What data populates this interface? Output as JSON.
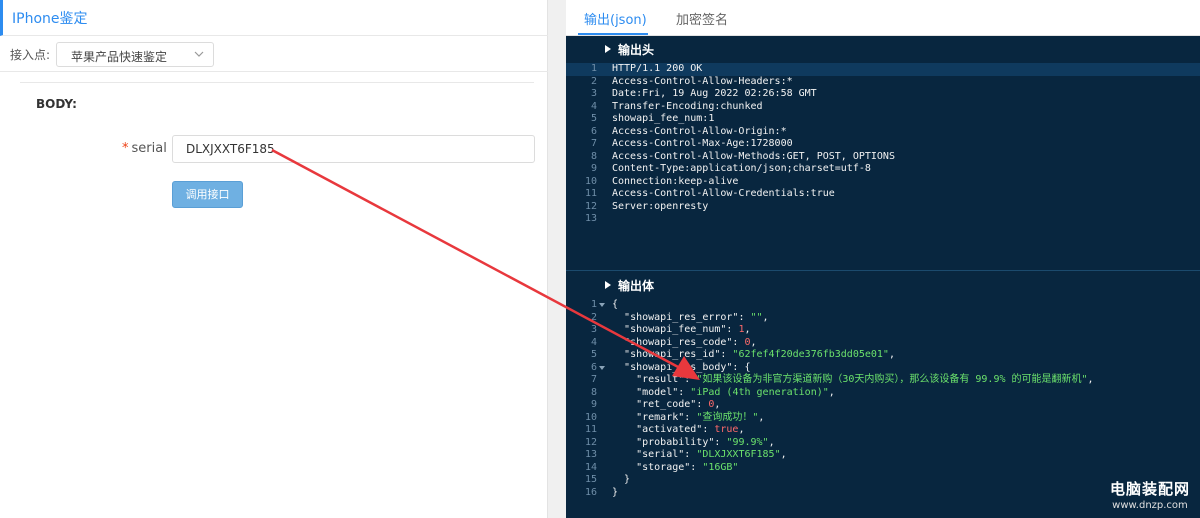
{
  "left": {
    "title": "IPhone鉴定",
    "endpoint_label": "接入点:",
    "endpoint_value": "苹果产品快速鉴定",
    "body_label": "BODY:",
    "field_required_mark": "*",
    "field_label": "serial",
    "field_value": "DLXJXXT6F185",
    "call_button": "调用接口"
  },
  "right": {
    "tabs": [
      {
        "label": "输出(json)",
        "active": true
      },
      {
        "label": "加密签名",
        "active": false
      }
    ],
    "headers_title": "输出头",
    "headers_lines": [
      {
        "n": "1",
        "t": "HTTP/1.1 200 OK"
      },
      {
        "n": "2",
        "t": "Access-Control-Allow-Headers:*"
      },
      {
        "n": "3",
        "t": "Date:Fri, 19 Aug 2022 02:26:58 GMT"
      },
      {
        "n": "4",
        "t": "Transfer-Encoding:chunked"
      },
      {
        "n": "5",
        "t": "showapi_fee_num:1"
      },
      {
        "n": "6",
        "t": "Access-Control-Allow-Origin:*"
      },
      {
        "n": "7",
        "t": "Access-Control-Max-Age:1728000"
      },
      {
        "n": "8",
        "t": "Access-Control-Allow-Methods:GET, POST, OPTIONS"
      },
      {
        "n": "9",
        "t": "Content-Type:application/json;charset=utf-8"
      },
      {
        "n": "10",
        "t": "Connection:keep-alive"
      },
      {
        "n": "11",
        "t": "Access-Control-Allow-Credentials:true"
      },
      {
        "n": "12",
        "t": "Server:openresty"
      },
      {
        "n": "13",
        "t": ""
      }
    ],
    "body_title": "输出体",
    "body_lines": [
      {
        "n": "1",
        "fold": true,
        "indent": "",
        "k": "",
        "sep": "",
        "v": "{",
        "vt": "p",
        "tail": ""
      },
      {
        "n": "2",
        "fold": false,
        "indent": "  ",
        "k": "\"showapi_res_error\"",
        "sep": ": ",
        "v": "\"\"",
        "vt": "s",
        "tail": ","
      },
      {
        "n": "3",
        "fold": false,
        "indent": "  ",
        "k": "\"showapi_fee_num\"",
        "sep": ": ",
        "v": "1",
        "vt": "n",
        "tail": ","
      },
      {
        "n": "4",
        "fold": false,
        "indent": "  ",
        "k": "\"showapi_res_code\"",
        "sep": ": ",
        "v": "0",
        "vt": "n",
        "tail": ","
      },
      {
        "n": "5",
        "fold": false,
        "indent": "  ",
        "k": "\"showapi_res_id\"",
        "sep": ": ",
        "v": "\"62fef4f20de376fb3dd05e01\"",
        "vt": "s",
        "tail": ","
      },
      {
        "n": "6",
        "fold": true,
        "indent": "  ",
        "k": "\"showapi_res_body\"",
        "sep": ": ",
        "v": "{",
        "vt": "p",
        "tail": ""
      },
      {
        "n": "7",
        "fold": false,
        "indent": "    ",
        "k": "\"result\"",
        "sep": ": ",
        "v": "\"如果该设备为非官方渠道新购（30天内购买），那么该设备有 99.9% 的可能是翻新机\"",
        "vt": "s",
        "tail": ","
      },
      {
        "n": "8",
        "fold": false,
        "indent": "    ",
        "k": "\"model\"",
        "sep": ": ",
        "v": "\"iPad (4th generation)\"",
        "vt": "s",
        "tail": ","
      },
      {
        "n": "9",
        "fold": false,
        "indent": "    ",
        "k": "\"ret_code\"",
        "sep": ": ",
        "v": "0",
        "vt": "n",
        "tail": ","
      },
      {
        "n": "10",
        "fold": false,
        "indent": "    ",
        "k": "\"remark\"",
        "sep": ": ",
        "v": "\"查询成功！\"",
        "vt": "s",
        "tail": ","
      },
      {
        "n": "11",
        "fold": false,
        "indent": "    ",
        "k": "\"activated\"",
        "sep": ": ",
        "v": "true",
        "vt": "b",
        "tail": ","
      },
      {
        "n": "12",
        "fold": false,
        "indent": "    ",
        "k": "\"probability\"",
        "sep": ": ",
        "v": "\"99.9%\"",
        "vt": "s",
        "tail": ","
      },
      {
        "n": "13",
        "fold": false,
        "indent": "    ",
        "k": "\"serial\"",
        "sep": ": ",
        "v": "\"DLXJXXT6F185\"",
        "vt": "s",
        "tail": ","
      },
      {
        "n": "14",
        "fold": false,
        "indent": "    ",
        "k": "\"storage\"",
        "sep": ": ",
        "v": "\"16GB\"",
        "vt": "s",
        "tail": ""
      },
      {
        "n": "15",
        "fold": false,
        "indent": "  ",
        "k": "",
        "sep": "",
        "v": "}",
        "vt": "p",
        "tail": ""
      },
      {
        "n": "16",
        "fold": false,
        "indent": "",
        "k": "",
        "sep": "",
        "v": "}",
        "vt": "p",
        "tail": ""
      }
    ]
  },
  "watermark": {
    "title": "电脑装配网",
    "url": "www.dnzp.com"
  },
  "colors": {
    "accent": "#2d8cf0",
    "editor_bg": "#08263f",
    "string": "#6ce26c",
    "number": "#ff6a6a",
    "annotation_arrow": "#e8383d"
  }
}
